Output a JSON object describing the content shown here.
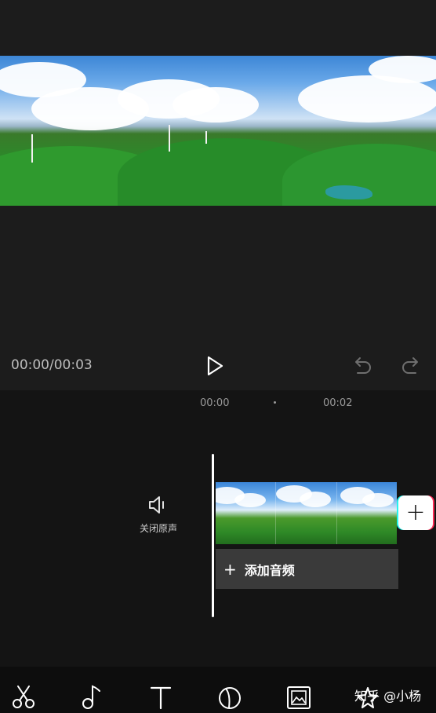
{
  "player": {
    "time_display": "00:00/00:03"
  },
  "timeline": {
    "ruler_labels": [
      "00:00",
      "00:02"
    ],
    "mute_label": "关闭原声",
    "add_audio_label": "添加音频",
    "add_audio_plus": "+",
    "add_clip_plus": "+",
    "clip_thumbnail_count": 3
  },
  "toolbar": {
    "tools": [
      "cut-icon",
      "music-icon",
      "text-icon",
      "sticker-icon",
      "picture-in-picture-icon",
      "effects-icon"
    ]
  },
  "watermark": "知乎 @小杨",
  "colors": {
    "background": "#1c1c1c",
    "timeline_background": "#141414",
    "track_background": "#3a3a3a",
    "accent_cyan": "#25f4ee",
    "accent_red": "#fe2c55"
  }
}
